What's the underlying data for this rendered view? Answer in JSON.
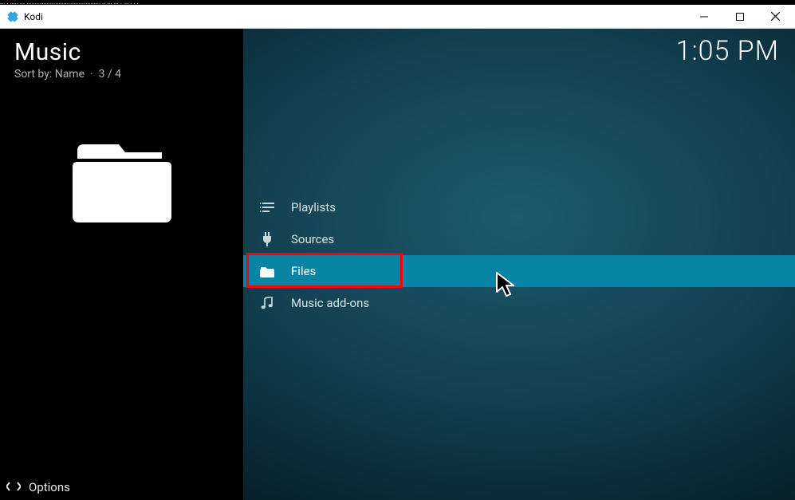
{
  "window": {
    "title": "Kodi",
    "garble": "...  . ..... ... ............................................ .. ... ... . ... . . ."
  },
  "sidebar": {
    "title": "Music",
    "sort_label": "Sort by: Name",
    "separator": "·",
    "position": "3 / 4"
  },
  "clock": "1:05 PM",
  "menu": {
    "items": [
      {
        "icon": "playlist-icon",
        "label": "Playlists",
        "selected": false
      },
      {
        "icon": "plug-icon",
        "label": "Sources",
        "selected": false
      },
      {
        "icon": "folder-icon",
        "label": "Files",
        "selected": true
      },
      {
        "icon": "music-note-icon",
        "label": "Music add-ons",
        "selected": false
      }
    ]
  },
  "footer": {
    "options_label": "Options"
  },
  "highlight": {
    "target_index": 2
  }
}
